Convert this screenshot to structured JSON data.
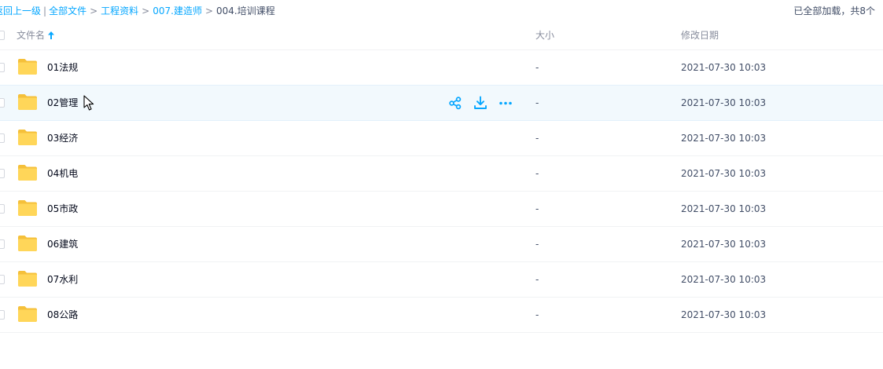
{
  "breadcrumb": {
    "back": "返回上一级",
    "bar": "|",
    "sep": ">",
    "all_files": "全部文件",
    "level1": "工程资料",
    "level2": "007.建造师",
    "current": "004.培训课程"
  },
  "status": {
    "loaded": "已全部加载，共8个"
  },
  "columns": {
    "name": "文件名",
    "size": "大小",
    "modified": "修改日期"
  },
  "files": [
    {
      "name": "01法规",
      "size": "-",
      "modified": "2021-07-30 10:03"
    },
    {
      "name": "02管理",
      "size": "-",
      "modified": "2021-07-30 10:03"
    },
    {
      "name": "03经济",
      "size": "-",
      "modified": "2021-07-30 10:03"
    },
    {
      "name": "04机电",
      "size": "-",
      "modified": "2021-07-30 10:03"
    },
    {
      "name": "05市政",
      "size": "-",
      "modified": "2021-07-30 10:03"
    },
    {
      "name": "06建筑",
      "size": "-",
      "modified": "2021-07-30 10:03"
    },
    {
      "name": "07水利",
      "size": "-",
      "modified": "2021-07-30 10:03"
    },
    {
      "name": "08公路",
      "size": "-",
      "modified": "2021-07-30 10:03"
    }
  ],
  "icons": {
    "folder": "folder-icon",
    "sort": "arrow-up-icon",
    "share": "share-icon",
    "download": "download-icon",
    "more": "more-icon"
  },
  "colors": {
    "accent": "#06a7ff",
    "folder": "#ffd659",
    "hover_row": "#f2f9fd"
  },
  "hovered_row_index": 1
}
